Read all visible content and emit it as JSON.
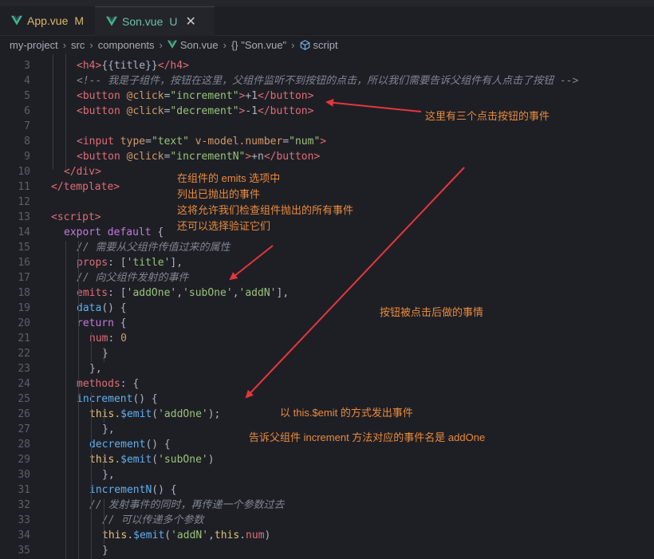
{
  "tabs": [
    {
      "name": "App.vue",
      "status": "M"
    },
    {
      "name": "Son.vue",
      "status": "U",
      "close": "✕"
    }
  ],
  "breadcrumb": {
    "parts": [
      "my-project",
      "src",
      "components"
    ],
    "file": "Son.vue",
    "symbol": "{} \"Son.vue\"",
    "section": "script"
  },
  "colors": {
    "annotation": "#e88a3c",
    "arrow": "#e5363a",
    "vue_green": "#41b883",
    "background": "#1e1f25"
  },
  "code": [
    {
      "n": "3",
      "tokens": [
        [
          "tag",
          "<h4>"
        ],
        [
          "pl",
          "{{title}}"
        ],
        [
          "tag",
          "</h4>"
        ]
      ]
    },
    {
      "n": "4",
      "tokens": [
        [
          "cmt",
          "<!-- 我是子组件，按钮在这里，父组件监听不到按钮的点击，所以我们需要告诉父组件有人点击了按钮 -->"
        ]
      ]
    },
    {
      "n": "5",
      "tokens": [
        [
          "tag",
          "<button "
        ],
        [
          "attr",
          "@click"
        ],
        [
          "pl",
          "="
        ],
        [
          "str",
          "\"increment\""
        ],
        [
          "tag",
          ">"
        ],
        [
          "pl",
          "+1"
        ],
        [
          "tag",
          "</button>"
        ]
      ]
    },
    {
      "n": "6",
      "tokens": [
        [
          "tag",
          "<button "
        ],
        [
          "attr",
          "@click"
        ],
        [
          "pl",
          "="
        ],
        [
          "str",
          "\"decrement\""
        ],
        [
          "tag",
          ">"
        ],
        [
          "pl",
          "-1"
        ],
        [
          "tag",
          "</button>"
        ]
      ]
    },
    {
      "n": "7",
      "tokens": []
    },
    {
      "n": "8",
      "tokens": [
        [
          "tag",
          "<input "
        ],
        [
          "attr",
          "type"
        ],
        [
          "pl",
          "="
        ],
        [
          "str",
          "\"text\""
        ],
        [
          "pl",
          " "
        ],
        [
          "attr",
          "v-model.number"
        ],
        [
          "pl",
          "="
        ],
        [
          "str",
          "\"num\""
        ],
        [
          "tag",
          ">"
        ]
      ]
    },
    {
      "n": "9",
      "tokens": [
        [
          "tag",
          "<button "
        ],
        [
          "attr",
          "@click"
        ],
        [
          "pl",
          "="
        ],
        [
          "str",
          "\"incrementN\""
        ],
        [
          "tag",
          ">"
        ],
        [
          "pl",
          "+n"
        ],
        [
          "tag",
          "</button>"
        ]
      ]
    },
    {
      "n": "10",
      "tokens": [
        [
          "tag",
          "</div>"
        ]
      ]
    },
    {
      "n": "11",
      "tokens": [
        [
          "tag",
          "</template>"
        ]
      ]
    },
    {
      "n": "12",
      "tokens": []
    },
    {
      "n": "13",
      "tokens": [
        [
          "tag",
          "<script>"
        ]
      ]
    },
    {
      "n": "14",
      "tokens": [
        [
          "kw",
          "export default"
        ],
        [
          "pl",
          " {"
        ]
      ]
    },
    {
      "n": "15",
      "tokens": [
        [
          "cmt",
          "// 需要从父组件传值过来的属性"
        ]
      ]
    },
    {
      "n": "16",
      "tokens": [
        [
          "prop",
          "props"
        ],
        [
          "pl",
          ": ["
        ],
        [
          "str",
          "'title'"
        ],
        [
          "pl",
          "],"
        ]
      ]
    },
    {
      "n": "17",
      "tokens": [
        [
          "cmt",
          "// 向父组件发射的事件"
        ]
      ]
    },
    {
      "n": "18",
      "tokens": [
        [
          "prop",
          "emits"
        ],
        [
          "pl",
          ": ["
        ],
        [
          "str",
          "'addOne'"
        ],
        [
          "pl",
          ","
        ],
        [
          "str",
          "'subOne'"
        ],
        [
          "pl",
          ","
        ],
        [
          "str",
          "'addN'"
        ],
        [
          "pl",
          "],"
        ]
      ]
    },
    {
      "n": "19",
      "tokens": [
        [
          "fn",
          "data"
        ],
        [
          "pl",
          "() {"
        ]
      ]
    },
    {
      "n": "20",
      "tokens": [
        [
          "kw",
          "return"
        ],
        [
          "pl",
          " {"
        ]
      ]
    },
    {
      "n": "21",
      "tokens": [
        [
          "prop",
          "num"
        ],
        [
          "pl",
          ": "
        ],
        [
          "num",
          "0"
        ]
      ]
    },
    {
      "n": "22",
      "tokens": [
        [
          "pl",
          "}"
        ]
      ]
    },
    {
      "n": "23",
      "tokens": [
        [
          "pl",
          "},"
        ]
      ]
    },
    {
      "n": "24",
      "tokens": [
        [
          "prop",
          "methods"
        ],
        [
          "pl",
          ": {"
        ]
      ]
    },
    {
      "n": "25",
      "tokens": [
        [
          "fn",
          "increment"
        ],
        [
          "pl",
          "() {"
        ]
      ]
    },
    {
      "n": "26",
      "tokens": [
        [
          "this",
          "this"
        ],
        [
          "pl",
          "."
        ],
        [
          "fn",
          "$emit"
        ],
        [
          "pl",
          "("
        ],
        [
          "str",
          "'addOne'"
        ],
        [
          "pl",
          ");"
        ]
      ]
    },
    {
      "n": "27",
      "tokens": [
        [
          "pl",
          "},"
        ]
      ]
    },
    {
      "n": "28",
      "tokens": [
        [
          "fn",
          "decrement"
        ],
        [
          "pl",
          "() {"
        ]
      ]
    },
    {
      "n": "29",
      "tokens": [
        [
          "this",
          "this"
        ],
        [
          "pl",
          "."
        ],
        [
          "fn",
          "$emit"
        ],
        [
          "pl",
          "("
        ],
        [
          "str",
          "'subOne'"
        ],
        [
          "pl",
          ")"
        ]
      ]
    },
    {
      "n": "30",
      "tokens": [
        [
          "pl",
          "},"
        ]
      ]
    },
    {
      "n": "31",
      "tokens": [
        [
          "fn",
          "incrementN"
        ],
        [
          "pl",
          "() {"
        ]
      ]
    },
    {
      "n": "32",
      "tokens": [
        [
          "cmt",
          "// 发射事件的同时，再传递一个参数过去"
        ]
      ]
    },
    {
      "n": "33",
      "tokens": [
        [
          "cmt",
          "// 可以传递多个参数"
        ]
      ]
    },
    {
      "n": "34",
      "tokens": [
        [
          "this",
          "this"
        ],
        [
          "pl",
          "."
        ],
        [
          "fn",
          "$emit"
        ],
        [
          "pl",
          "("
        ],
        [
          "str",
          "'addN'"
        ],
        [
          "pl",
          ","
        ],
        [
          "this",
          "this"
        ],
        [
          "pl",
          "."
        ],
        [
          "prop",
          "num"
        ],
        [
          "pl",
          ")"
        ]
      ]
    },
    {
      "n": "35",
      "tokens": [
        [
          "pl",
          "}"
        ]
      ]
    }
  ],
  "annotations": {
    "buttons": "这里有三个点击按钮的事件",
    "emits_lines": [
      "在组件的 emits 选项中",
      "列出已抛出的事件",
      "这将允许我们检查组件抛出的所有事件",
      "还可以选择验证它们"
    ],
    "click_after": "按钮被点击后做的事情",
    "emit_way": "以 this.$emit 的方式发出事件",
    "tell_parent": "告诉父组件 increment 方法对应的事件名是 addOne"
  }
}
